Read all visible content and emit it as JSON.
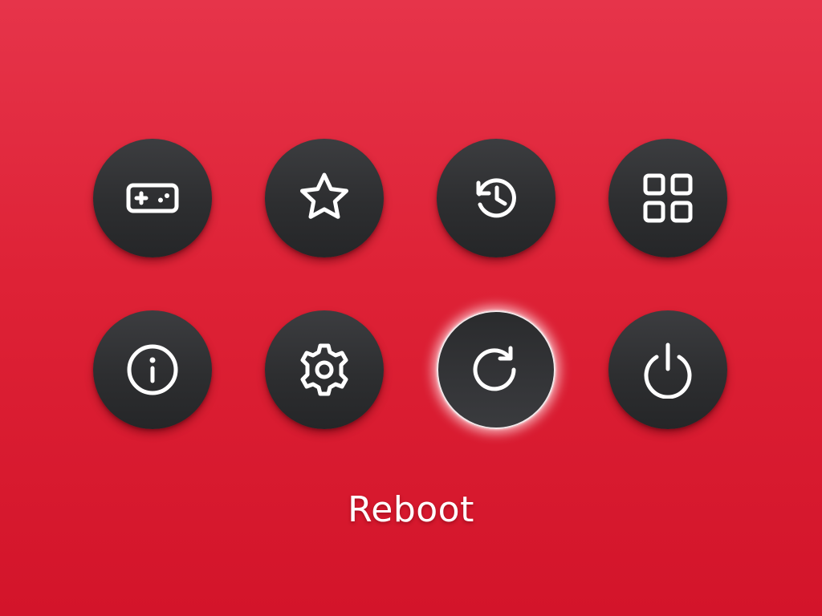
{
  "menu": {
    "items": [
      {
        "id": "games",
        "icon": "gamepad-icon",
        "selected": false
      },
      {
        "id": "favorites",
        "icon": "star-icon",
        "selected": false
      },
      {
        "id": "history",
        "icon": "history-icon",
        "selected": false
      },
      {
        "id": "apps",
        "icon": "grid-icon",
        "selected": false
      },
      {
        "id": "info",
        "icon": "info-icon",
        "selected": false
      },
      {
        "id": "settings",
        "icon": "gear-icon",
        "selected": false
      },
      {
        "id": "reboot",
        "icon": "refresh-icon",
        "selected": true
      },
      {
        "id": "power",
        "icon": "power-icon",
        "selected": false
      }
    ],
    "selected_index": 6
  },
  "caption": {
    "label": "Reboot"
  },
  "colors": {
    "background_top": "#e6344a",
    "background_bottom": "#d3142a",
    "button": "#2d2e30",
    "icon": "#ffffff",
    "selection_glow": "#f3e8ea"
  }
}
